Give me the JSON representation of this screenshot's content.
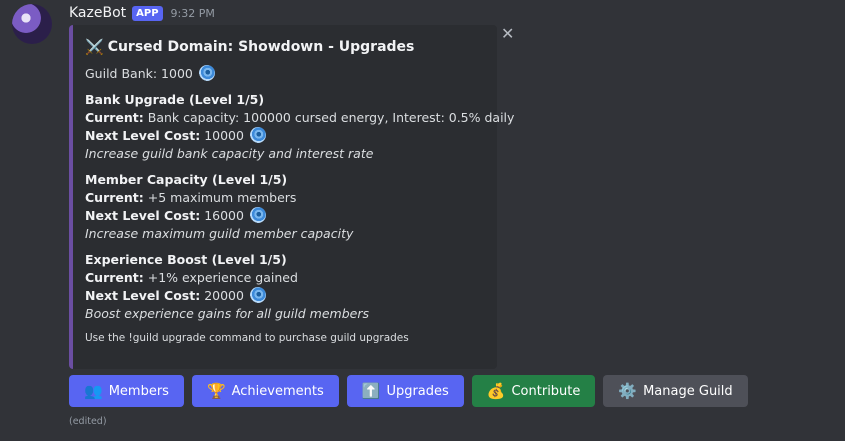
{
  "message": {
    "username": "KazeBot",
    "tag": "APP",
    "time": "9:32 PM",
    "edited": "(edited)"
  },
  "embed": {
    "accent_color": "#6b4ea2",
    "title_icon": "crossed-swords-icon",
    "title": "Cursed Domain: Showdown - Upgrades",
    "bank_label": "Guild Bank: 1000",
    "currency_icon": "swirl-icon",
    "upgrades": [
      {
        "name": "Bank Upgrade (Level 1/5)",
        "current_label": "Current:",
        "current_value": "Bank capacity: 100000 cursed energy, Interest: 0.5% daily",
        "cost_label": "Next Level Cost:",
        "cost_value": "10000",
        "description": "Increase guild bank capacity and interest rate"
      },
      {
        "name": "Member Capacity (Level 1/5)",
        "current_label": "Current:",
        "current_value": "+5 maximum members",
        "cost_label": "Next Level Cost:",
        "cost_value": "16000",
        "description": "Increase maximum guild member capacity"
      },
      {
        "name": "Experience Boost (Level 1/5)",
        "current_label": "Current:",
        "current_value": "+1% experience gained",
        "cost_label": "Next Level Cost:",
        "cost_value": "20000",
        "description": "Boost experience gains for all guild members"
      }
    ],
    "footer": "Use the !guild upgrade command to purchase guild upgrades"
  },
  "buttons": [
    {
      "label": "Members",
      "icon": "people-icon",
      "glyph": "👥",
      "style": "primary"
    },
    {
      "label": "Achievements",
      "icon": "trophy-icon",
      "glyph": "🏆",
      "style": "primary"
    },
    {
      "label": "Upgrades",
      "icon": "up-arrow-icon",
      "glyph": "⬆️",
      "style": "primary"
    },
    {
      "label": "Contribute",
      "icon": "money-bag-icon",
      "glyph": "💰",
      "style": "success"
    },
    {
      "label": "Manage Guild",
      "icon": "gear-icon",
      "glyph": "⚙️",
      "style": "secondary"
    }
  ],
  "colors": {
    "primary": "#5865f2",
    "success": "#248046",
    "secondary": "#4e5058"
  }
}
